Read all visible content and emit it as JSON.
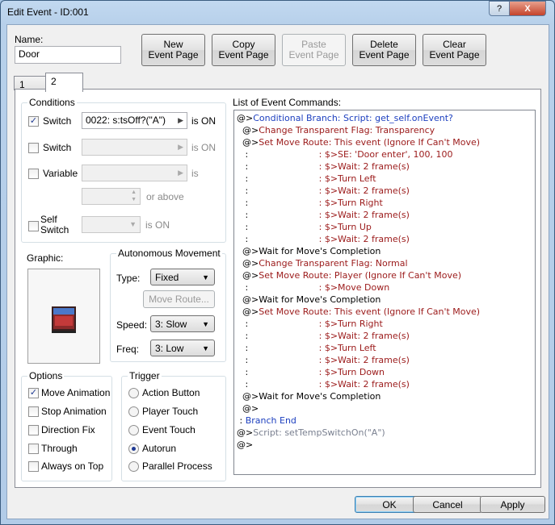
{
  "window": {
    "title": "Edit Event - ID:001",
    "help_label": "?",
    "close_label": "X"
  },
  "name_label": "Name:",
  "name_value": "Door",
  "toolbar": {
    "new_page": [
      "New",
      "Event Page"
    ],
    "copy_page": [
      "Copy",
      "Event Page"
    ],
    "paste_page": [
      "Paste",
      "Event Page"
    ],
    "delete_page": [
      "Delete",
      "Event Page"
    ],
    "clear_page": [
      "Clear",
      "Event Page"
    ]
  },
  "tabs": [
    {
      "label": "1"
    },
    {
      "label": "2"
    }
  ],
  "conditions": {
    "title": "Conditions",
    "switch1": {
      "label": "Switch",
      "checked": true,
      "value": "0022: s:tsOff?(\"A\")",
      "suffix": "is ON"
    },
    "switch2": {
      "label": "Switch",
      "checked": false,
      "value": "",
      "suffix": "is ON"
    },
    "variable": {
      "label": "Variable",
      "checked": false,
      "value": "",
      "suffix": "is",
      "above": "or above"
    },
    "self_switch": {
      "label1": "Self",
      "label2": "Switch",
      "checked": false,
      "suffix": "is ON"
    }
  },
  "graphic": {
    "title": "Graphic:"
  },
  "autonomous": {
    "title": "Autonomous Movement",
    "type_label": "Type:",
    "type_value": "Fixed",
    "move_route": "Move Route...",
    "speed_label": "Speed:",
    "speed_value": "3: Slow",
    "freq_label": "Freq:",
    "freq_value": "3: Low"
  },
  "options": {
    "title": "Options",
    "items": [
      {
        "label": "Move Animation",
        "checked": true
      },
      {
        "label": "Stop Animation",
        "checked": false
      },
      {
        "label": "Direction Fix",
        "checked": false
      },
      {
        "label": "Through",
        "checked": false
      },
      {
        "label": "Always on Top",
        "checked": false
      }
    ]
  },
  "trigger": {
    "title": "Trigger",
    "items": [
      {
        "label": "Action Button",
        "selected": false
      },
      {
        "label": "Player Touch",
        "selected": false
      },
      {
        "label": "Event Touch",
        "selected": false
      },
      {
        "label": "Autorun",
        "selected": true
      },
      {
        "label": "Parallel Process",
        "selected": false
      }
    ]
  },
  "commands_title": "List of Event Commands:",
  "commands": [
    {
      "prefix": "@>",
      "text": "Conditional Branch: Script: get_self.onEvent?",
      "color": "blue"
    },
    {
      "prefix": "  @>",
      "text": "Change Transparent Flag: Transparency",
      "color": "red"
    },
    {
      "prefix": "  @>",
      "text": "Set Move Route: This event (Ignore If Can't Move)",
      "color": "red"
    },
    {
      "prefix": "   :",
      "text": "                         : $>SE: 'Door enter', 100, 100",
      "color": "red"
    },
    {
      "prefix": "   :",
      "text": "                         : $>Wait: 2 frame(s)",
      "color": "red"
    },
    {
      "prefix": "   :",
      "text": "                         : $>Turn Left",
      "color": "red"
    },
    {
      "prefix": "   :",
      "text": "                         : $>Wait: 2 frame(s)",
      "color": "red"
    },
    {
      "prefix": "   :",
      "text": "                         : $>Turn Right",
      "color": "red"
    },
    {
      "prefix": "   :",
      "text": "                         : $>Wait: 2 frame(s)",
      "color": "red"
    },
    {
      "prefix": "   :",
      "text": "                         : $>Turn Up",
      "color": "red"
    },
    {
      "prefix": "   :",
      "text": "                         : $>Wait: 2 frame(s)",
      "color": "red"
    },
    {
      "prefix": "  @>",
      "text": "Wait for Move's Completion",
      "color": "black"
    },
    {
      "prefix": "  @>",
      "text": "Change Transparent Flag: Normal",
      "color": "red"
    },
    {
      "prefix": "  @>",
      "text": "Set Move Route: Player (Ignore If Can't Move)",
      "color": "red"
    },
    {
      "prefix": "   :",
      "text": "                         : $>Move Down",
      "color": "red"
    },
    {
      "prefix": "  @>",
      "text": "Wait for Move's Completion",
      "color": "black"
    },
    {
      "prefix": "  @>",
      "text": "Set Move Route: This event (Ignore If Can't Move)",
      "color": "red"
    },
    {
      "prefix": "   :",
      "text": "                         : $>Turn Right",
      "color": "red"
    },
    {
      "prefix": "   :",
      "text": "                         : $>Wait: 2 frame(s)",
      "color": "red"
    },
    {
      "prefix": "   :",
      "text": "                         : $>Turn Left",
      "color": "red"
    },
    {
      "prefix": "   :",
      "text": "                         : $>Wait: 2 frame(s)",
      "color": "red"
    },
    {
      "prefix": "   :",
      "text": "                         : $>Turn Down",
      "color": "red"
    },
    {
      "prefix": "   :",
      "text": "                         : $>Wait: 2 frame(s)",
      "color": "red"
    },
    {
      "prefix": "  @>",
      "text": "Wait for Move's Completion",
      "color": "black"
    },
    {
      "prefix": "  @>",
      "text": "",
      "color": "black"
    },
    {
      "prefix": " : ",
      "text": "Branch End",
      "color": "blue"
    },
    {
      "prefix": "@>",
      "text": "Script: setTempSwitchOn(\"A\")",
      "color": "gray"
    },
    {
      "prefix": "@>",
      "text": "",
      "color": "black"
    }
  ],
  "footer": {
    "ok": "OK",
    "cancel": "Cancel",
    "apply": "Apply"
  },
  "colors": {
    "command_blue": "#1c3fbf",
    "command_red": "#9b1a1a",
    "command_gray": "#7a8090"
  }
}
